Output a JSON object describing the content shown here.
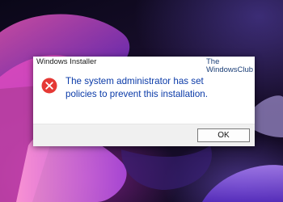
{
  "dialog": {
    "title": "Windows Installer",
    "message": "The system administrator has set policies to prevent this installation.",
    "ok_label": "OK",
    "icon": "error-icon",
    "accent_color": "#0a3aa8",
    "error_color": "#e53935"
  },
  "watermark": {
    "line1": "The",
    "line2": "WindowsClub"
  }
}
